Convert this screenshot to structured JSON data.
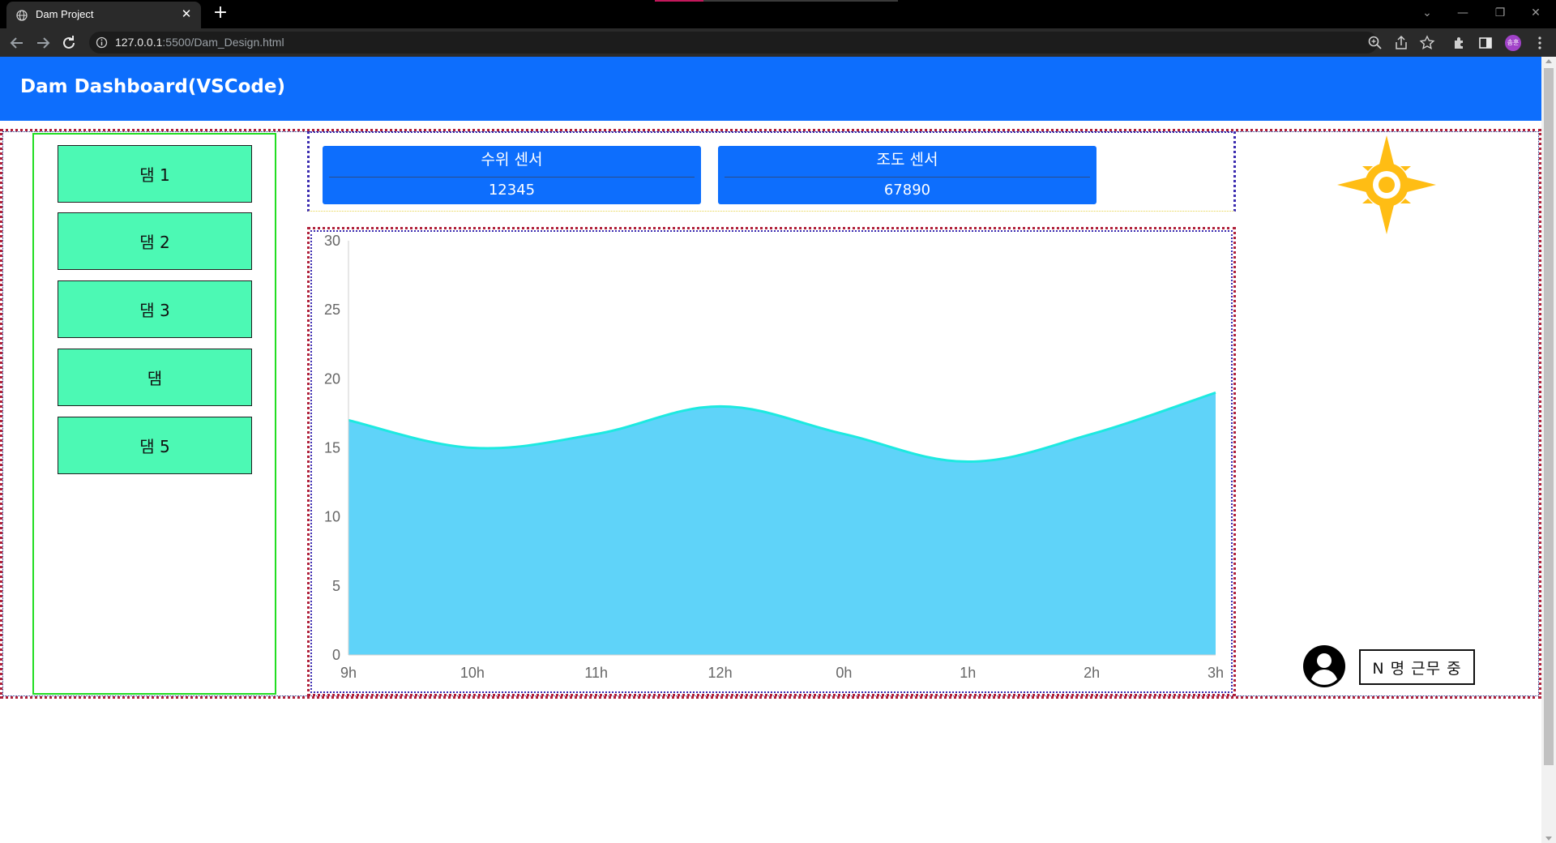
{
  "browser": {
    "tab_title": "Dam Project",
    "tab_close": "✕",
    "new_tab": "+",
    "url_host": "127.0.0.1",
    "url_rest": ":5500/Dam_Design.html",
    "profile_initials": "송훈",
    "window_controls": [
      "⌄",
      "—",
      "❐",
      "✕"
    ]
  },
  "header": {
    "title": "Dam Dashboard(VSCode)"
  },
  "sidebar": {
    "items": [
      {
        "label": "댐 1"
      },
      {
        "label": "댐 2"
      },
      {
        "label": "댐 3"
      },
      {
        "label": "댐"
      },
      {
        "label": "댐 5"
      }
    ]
  },
  "sensors": [
    {
      "label": "수위 센서",
      "value": "12345"
    },
    {
      "label": "조도 센서",
      "value": "67890"
    }
  ],
  "status": {
    "duty_text": "N 명 근무 중"
  },
  "icons": {
    "weather": "sun-icon",
    "user": "user-avatar-icon"
  },
  "colors": {
    "header": "#0d6efd",
    "button": "#4cf9b4",
    "area_fill": "#5fd3f9",
    "area_line": "#1de9e0",
    "sun": "#ffbd14"
  },
  "chart_data": {
    "type": "area",
    "categories": [
      "9h",
      "10h",
      "11h",
      "12h",
      "0h",
      "1h",
      "2h",
      "3h"
    ],
    "series": [
      {
        "values": [
          17,
          15,
          16,
          18,
          16,
          14,
          16,
          19
        ]
      }
    ],
    "yticks": [
      0,
      5,
      10,
      15,
      20,
      25,
      30
    ],
    "ylim": [
      0,
      30
    ],
    "title": "",
    "xlabel": "",
    "ylabel": "",
    "grid": false,
    "legend": "none"
  }
}
